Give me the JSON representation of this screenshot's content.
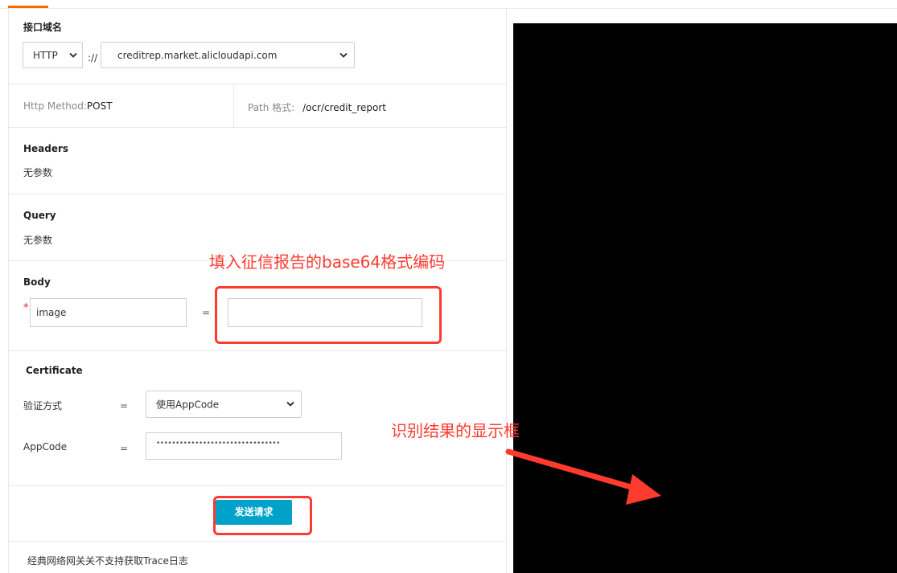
{
  "colors": {
    "accent": "#ff6a00",
    "annotation": "#ff3b30",
    "send_button": "#00a2ca",
    "result_panel": "#000000"
  },
  "domain_section": {
    "title": "接口域名",
    "protocol": "HTTP",
    "separator": "://",
    "host": "creditrep.market.alicloudapi.com"
  },
  "method_path": {
    "method_label": "Http Method:",
    "method_value": "POST",
    "path_label": "Path 格式:",
    "path_value": "/ocr/credit_report"
  },
  "headers": {
    "title": "Headers",
    "empty_text": "无参数"
  },
  "query": {
    "title": "Query",
    "empty_text": "无参数"
  },
  "body": {
    "title": "Body",
    "required_mark": "*",
    "param_name": "image",
    "equals": "=",
    "param_value": ""
  },
  "certificate": {
    "title": "Certificate",
    "auth_label": "验证方式",
    "auth_equals": "=",
    "auth_value": "使用AppCode",
    "appcode_label": "AppCode",
    "appcode_equals": "=",
    "appcode_value": "••••••••••••••••••••••••••••••••"
  },
  "actions": {
    "send_label": "发送请求"
  },
  "footer": {
    "trace_note": "经典网络网关关不支持获取Trace日志"
  },
  "annotations": {
    "body_hint": "填入征信报告的base64格式编码",
    "result_hint": "识别结果的显示框"
  }
}
